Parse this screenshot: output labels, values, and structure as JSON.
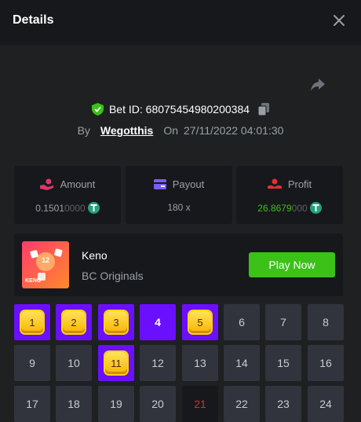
{
  "header": {
    "title": "Details"
  },
  "bet": {
    "id_label": "Bet ID: 68075454980200384",
    "by_label": "By",
    "user": "Wegotthis",
    "on_label": "On",
    "datetime": "27/11/2022 04:01:30"
  },
  "stats": {
    "amount": {
      "label": "Amount",
      "value_main": "0.1501",
      "value_dim": "0000",
      "icon": "hand-coin-icon"
    },
    "payout": {
      "label": "Payout",
      "value": "180 x",
      "icon": "wallet-icon"
    },
    "profit": {
      "label": "Profit",
      "value_main": "26.8679",
      "value_dim": "000",
      "icon": "hand-profit-icon"
    }
  },
  "game": {
    "name": "Keno",
    "provider": "BC Originals",
    "thumb_label": "KENO",
    "thumb_ball": "12",
    "play_label": "Play Now"
  },
  "board": {
    "cells": [
      {
        "n": "1",
        "state": "hit"
      },
      {
        "n": "2",
        "state": "hit"
      },
      {
        "n": "3",
        "state": "hit"
      },
      {
        "n": "4",
        "state": "picked"
      },
      {
        "n": "5",
        "state": "hit"
      },
      {
        "n": "6",
        "state": "normal"
      },
      {
        "n": "7",
        "state": "normal"
      },
      {
        "n": "8",
        "state": "normal"
      },
      {
        "n": "9",
        "state": "normal"
      },
      {
        "n": "10",
        "state": "normal"
      },
      {
        "n": "11",
        "state": "hit"
      },
      {
        "n": "12",
        "state": "normal"
      },
      {
        "n": "13",
        "state": "normal"
      },
      {
        "n": "14",
        "state": "normal"
      },
      {
        "n": "15",
        "state": "normal"
      },
      {
        "n": "16",
        "state": "normal"
      },
      {
        "n": "17",
        "state": "normal"
      },
      {
        "n": "18",
        "state": "normal"
      },
      {
        "n": "19",
        "state": "normal"
      },
      {
        "n": "20",
        "state": "normal"
      },
      {
        "n": "21",
        "state": "drawn"
      },
      {
        "n": "22",
        "state": "normal"
      },
      {
        "n": "23",
        "state": "normal"
      },
      {
        "n": "24",
        "state": "normal"
      }
    ]
  },
  "colors": {
    "accent_green": "#3bc117",
    "picked_purple": "#6b0fff",
    "drawn_red": "#ea2525",
    "tether_green": "#26a17b"
  }
}
